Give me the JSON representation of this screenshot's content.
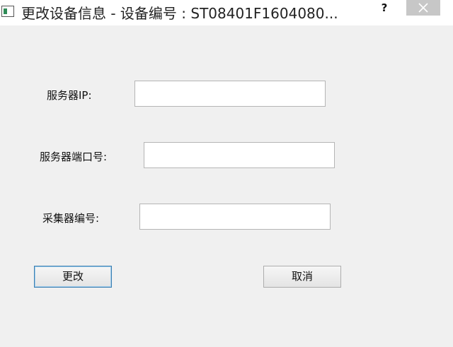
{
  "window": {
    "title": "更改设备信息 - 设备编号 : ST08401F1604080...",
    "help_glyph": "?",
    "close_glyph": "close-icon"
  },
  "form": {
    "server_ip_label": "服务器IP:",
    "server_ip_value": "",
    "server_port_label": "服务器端口号:",
    "server_port_value": "",
    "collector_id_label": "采集器编号:",
    "collector_id_value": ""
  },
  "buttons": {
    "change_label": "更改",
    "cancel_label": "取消"
  }
}
